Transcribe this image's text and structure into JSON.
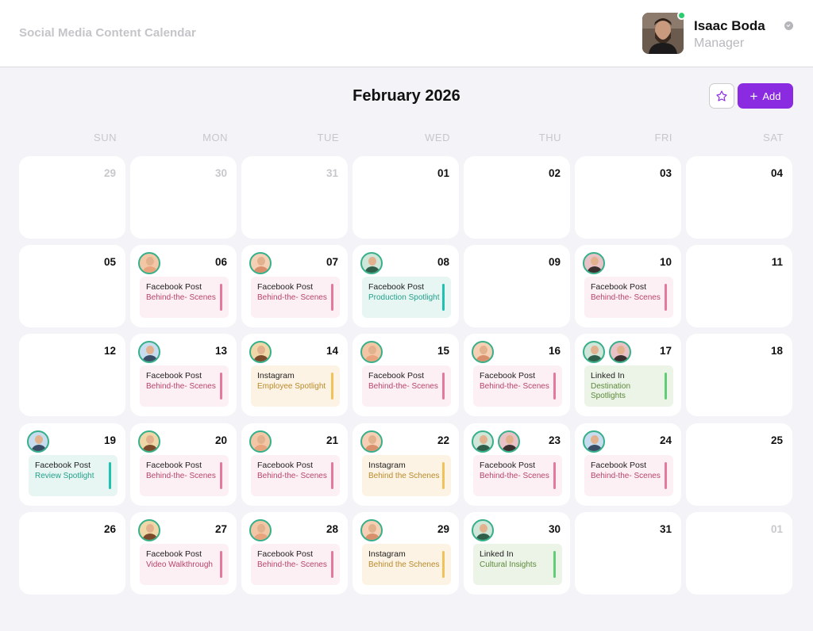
{
  "app": {
    "title": "Social Media Content Calendar"
  },
  "user": {
    "name": "Isaac Boda",
    "role": "Manager",
    "status_color": "#2ecc71"
  },
  "calendar": {
    "month_label": "February 2026",
    "add_label": "Add",
    "accent_color": "#8a2be2",
    "weekdays": [
      "SUN",
      "MON",
      "TUE",
      "WED",
      "THU",
      "FRI",
      "SAT"
    ],
    "weeks": [
      [
        {
          "day": "29",
          "muted": true,
          "avatars": 0,
          "event": null
        },
        {
          "day": "30",
          "muted": true,
          "avatars": 0,
          "event": null
        },
        {
          "day": "31",
          "muted": true,
          "avatars": 0,
          "event": null
        },
        {
          "day": "01",
          "muted": false,
          "avatars": 0,
          "event": null
        },
        {
          "day": "02",
          "muted": false,
          "avatars": 0,
          "event": null
        },
        {
          "day": "03",
          "muted": false,
          "avatars": 0,
          "event": null
        },
        {
          "day": "04",
          "muted": false,
          "avatars": 0,
          "event": null
        }
      ],
      [
        {
          "day": "05",
          "muted": false,
          "avatars": 0,
          "event": null
        },
        {
          "day": "06",
          "muted": false,
          "avatars": 1,
          "event": {
            "type": "Facebook Post",
            "title": "Behind-the- Scenes",
            "color": "pink"
          }
        },
        {
          "day": "07",
          "muted": false,
          "avatars": 1,
          "event": {
            "type": "Facebook Post",
            "title": "Behind-the- Scenes",
            "color": "pink"
          }
        },
        {
          "day": "08",
          "muted": false,
          "avatars": 1,
          "event": {
            "type": "Facebook Post",
            "title": "Production Spotlight",
            "color": "teal"
          }
        },
        {
          "day": "09",
          "muted": false,
          "avatars": 0,
          "event": null
        },
        {
          "day": "10",
          "muted": false,
          "avatars": 1,
          "event": {
            "type": "Facebook Post",
            "title": "Behind-the- Scenes",
            "color": "pink"
          }
        },
        {
          "day": "11",
          "muted": false,
          "avatars": 0,
          "event": null
        }
      ],
      [
        {
          "day": "12",
          "muted": false,
          "avatars": 0,
          "event": null
        },
        {
          "day": "13",
          "muted": false,
          "avatars": 1,
          "event": {
            "type": "Facebook Post",
            "title": "Behind-the- Scenes",
            "color": "pink"
          }
        },
        {
          "day": "14",
          "muted": false,
          "avatars": 1,
          "event": {
            "type": "Instagram",
            "title": "Employee Spotlight",
            "color": "yellow"
          }
        },
        {
          "day": "15",
          "muted": false,
          "avatars": 1,
          "event": {
            "type": "Facebook Post",
            "title": "Behind-the- Scenes",
            "color": "pink"
          }
        },
        {
          "day": "16",
          "muted": false,
          "avatars": 1,
          "event": {
            "type": "Facebook Post",
            "title": "Behind-the- Scenes",
            "color": "pink"
          }
        },
        {
          "day": "17",
          "muted": false,
          "avatars": 2,
          "event": {
            "type": "Linked In",
            "title": "Destination Spotlights",
            "color": "green"
          }
        },
        {
          "day": "18",
          "muted": false,
          "avatars": 0,
          "event": null
        }
      ],
      [
        {
          "day": "19",
          "muted": false,
          "avatars": 1,
          "event": {
            "type": "Facebook Post",
            "title": "Review Spotlight",
            "color": "teal"
          }
        },
        {
          "day": "20",
          "muted": false,
          "avatars": 1,
          "event": {
            "type": "Facebook Post",
            "title": "Behind-the- Scenes",
            "color": "pink"
          }
        },
        {
          "day": "21",
          "muted": false,
          "avatars": 1,
          "event": {
            "type": "Facebook Post",
            "title": "Behind-the- Scenes",
            "color": "pink"
          }
        },
        {
          "day": "22",
          "muted": false,
          "avatars": 1,
          "event": {
            "type": "Instagram",
            "title": "Behind the Schenes",
            "color": "yellow"
          }
        },
        {
          "day": "23",
          "muted": false,
          "avatars": 2,
          "event": {
            "type": "Facebook Post",
            "title": "Behind-the- Scenes",
            "color": "pink"
          }
        },
        {
          "day": "24",
          "muted": false,
          "avatars": 1,
          "event": {
            "type": "Facebook Post",
            "title": "Behind-the- Scenes",
            "color": "pink"
          }
        },
        {
          "day": "25",
          "muted": false,
          "avatars": 0,
          "event": null
        }
      ],
      [
        {
          "day": "26",
          "muted": false,
          "avatars": 0,
          "event": null
        },
        {
          "day": "27",
          "muted": false,
          "avatars": 1,
          "event": {
            "type": "Facebook Post",
            "title": "Video Walkthrough",
            "color": "pink"
          }
        },
        {
          "day": "28",
          "muted": false,
          "avatars": 1,
          "event": {
            "type": "Facebook Post",
            "title": "Behind-the- Scenes",
            "color": "pink"
          }
        },
        {
          "day": "29",
          "muted": false,
          "avatars": 1,
          "event": {
            "type": "Instagram",
            "title": "Behind the Schenes",
            "color": "yellow"
          }
        },
        {
          "day": "30",
          "muted": false,
          "avatars": 1,
          "event": {
            "type": "Linked In",
            "title": "Cultural Insights",
            "color": "green"
          }
        },
        {
          "day": "31",
          "muted": false,
          "avatars": 0,
          "event": null
        },
        {
          "day": "01",
          "muted": true,
          "avatars": 0,
          "event": null
        }
      ]
    ]
  }
}
